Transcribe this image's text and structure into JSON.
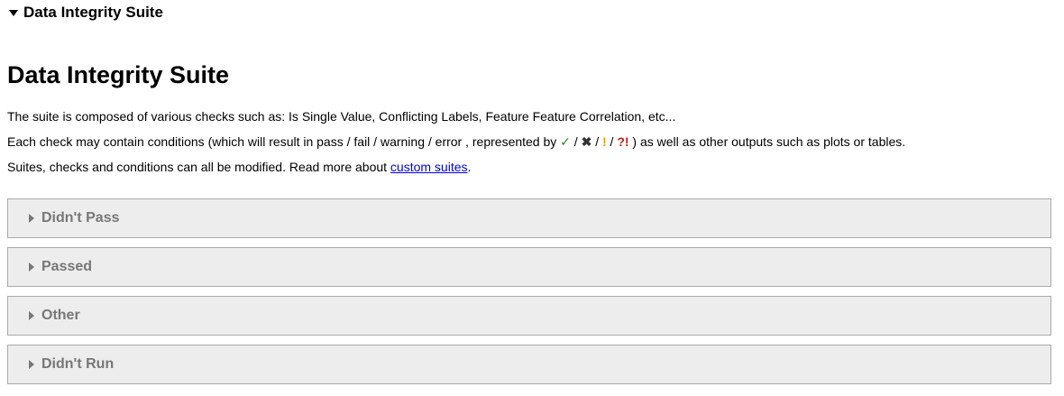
{
  "summary": {
    "label": "Data Integrity Suite"
  },
  "title": "Data Integrity Suite",
  "intro": {
    "line1": "The suite is composed of various checks such as: Is Single Value, Conflicting Labels, Feature Feature Correlation, etc...",
    "line2_before": "Each check may contain conditions (which will result in pass / fail / warning / error , represented by ",
    "symbols": {
      "pass": "✓",
      "fail": "✖",
      "warning": "!",
      "error": "?!",
      "separator": " / "
    },
    "line2_after": " ) as well as other outputs such as plots or tables.",
    "line3_before": "Suites, checks and conditions can all be modified. Read more about ",
    "line3_link": "custom suites",
    "line3_after": "."
  },
  "sections": [
    {
      "label": "Didn't Pass"
    },
    {
      "label": "Passed"
    },
    {
      "label": "Other"
    },
    {
      "label": "Didn't Run"
    }
  ],
  "colors": {
    "pass": "#2e8b2e",
    "fail": "#333333",
    "warning": "#f0a000",
    "error": "#c0201b",
    "link": "#0000ee",
    "section_bg": "#ededed",
    "section_text": "#777777"
  }
}
